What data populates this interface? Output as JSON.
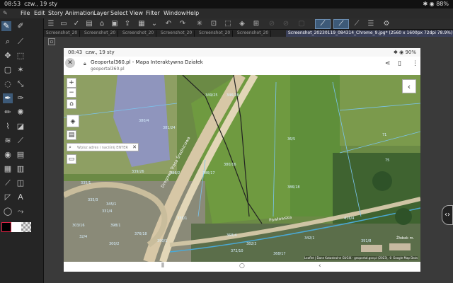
{
  "tablet_status": {
    "time": "08:53",
    "date": "czw., 19 sty",
    "battery": "88%"
  },
  "menu": [
    "File",
    "Edit",
    "Story",
    "Animation",
    "Layer",
    "Select",
    "View",
    "Filter",
    "Window",
    "Help"
  ],
  "tabs": [
    {
      "label": "Screenshot_20"
    },
    {
      "label": "Screenshot_20"
    },
    {
      "label": "Screenshot_20"
    },
    {
      "label": "Screenshot_20"
    },
    {
      "label": "Screenshot_20"
    },
    {
      "label": "Screenshot_20"
    },
    {
      "label": "Screenshot_20230119_084314_Chrome_9.jpg* (2560 x 1600px 72dpi 78.9%)"
    }
  ],
  "phone": {
    "status_time": "08:43",
    "status_date": "czw., 19 sty",
    "battery": "90%",
    "page_title": "Geoportal360.pl - Mapa Interaktywna Działek",
    "page_url": "geoportal360.pl"
  },
  "map": {
    "search_placeholder": "Wpisz adres i naciśnij ENTER",
    "zoom_in": "+",
    "zoom_out": "−",
    "attribution": "Leaflet | Dane Katastralne GUGiK - geoportal.gov.pl (2023), © Google Map Data",
    "street_label": "Pawłowska",
    "road_label": "Drogowa Trasa Średnicowa",
    "parcels": [
      "380/4",
      "349/25",
      "346/28",
      "381/24",
      "386/17",
      "380/16",
      "386/18",
      "36/5",
      "71",
      "75",
      "335/1",
      "335/3",
      "331/4",
      "398/1",
      "300/2",
      "376/18",
      "339/26",
      "416/4",
      "368/4",
      "372/10",
      "342/1",
      "303/16",
      "368/17",
      "390/1",
      "335/1",
      "386/2",
      "382/3",
      "391/8",
      "32/4",
      "345/1"
    ],
    "place_label": "Żłobek m."
  }
}
